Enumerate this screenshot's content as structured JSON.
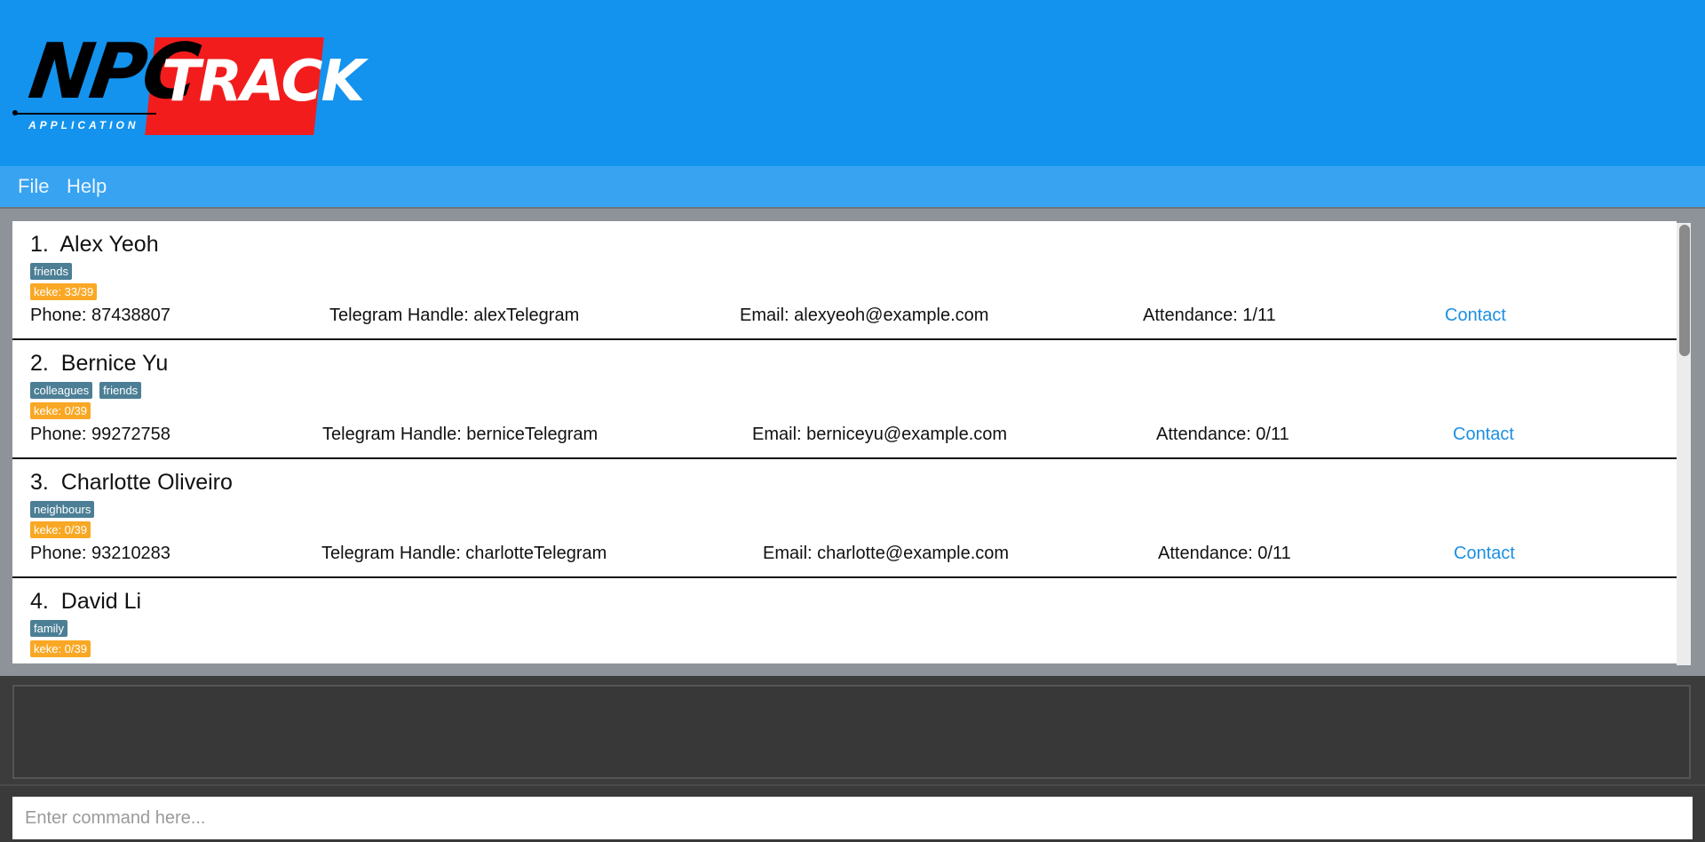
{
  "logo": {
    "word1": "NPC",
    "word2": "TRACK",
    "tagline": "APPLICATION"
  },
  "menu": {
    "file_label": "File",
    "help_label": "Help"
  },
  "persons": [
    {
      "index": "1.",
      "name": "Alex Yeoh",
      "tags": [
        "friends"
      ],
      "keke": "keke: 33/39",
      "phone": "Phone: 87438807",
      "telegram": "Telegram Handle: alexTelegram",
      "email": "Email: alexyeoh@example.com",
      "attendance": "Attendance: 1/11",
      "contact": "Contact"
    },
    {
      "index": "2.",
      "name": "Bernice Yu",
      "tags": [
        "colleagues",
        "friends"
      ],
      "keke": "keke: 0/39",
      "phone": "Phone: 99272758",
      "telegram": "Telegram Handle: berniceTelegram",
      "email": "Email: berniceyu@example.com",
      "attendance": "Attendance: 0/11",
      "contact": "Contact"
    },
    {
      "index": "3.",
      "name": "Charlotte Oliveiro",
      "tags": [
        "neighbours"
      ],
      "keke": "keke: 0/39",
      "phone": "Phone: 93210283",
      "telegram": "Telegram Handle: charlotteTelegram",
      "email": "Email: charlotte@example.com",
      "attendance": "Attendance: 0/11",
      "contact": "Contact"
    },
    {
      "index": "4.",
      "name": "David Li",
      "tags": [
        "family"
      ],
      "keke": "keke: 0/39"
    }
  ],
  "result_display": "",
  "command": {
    "value": "",
    "placeholder": "Enter command here..."
  },
  "colors": {
    "banner": "#1393ee",
    "menubar": "#38a3f1",
    "tag": "#4c7f95",
    "keke": "#f9a825",
    "contact_link": "#1c8fe3",
    "logo_red": "#f21c1c"
  }
}
